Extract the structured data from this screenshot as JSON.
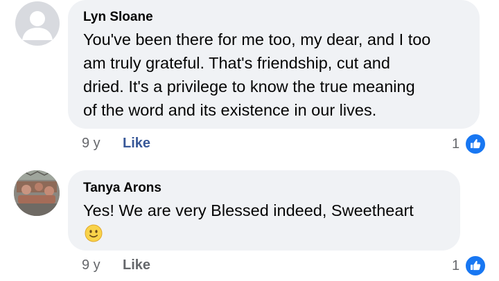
{
  "comments": [
    {
      "author": "Lyn Sloane",
      "text_lines": [
        "You've been there for me too, my dear, and I too",
        "am truly grateful.  That's friendship, cut and",
        "dried.  It's a privilege to know the true meaning",
        "of the word and its existence in our lives."
      ],
      "age": "9 y",
      "like_label": "Like",
      "reaction_count": "1",
      "avatar": "default-profile-avatar",
      "liked": true
    },
    {
      "author": "Tanya Arons",
      "text_lines": [
        "Yes!  We are very Blessed indeed, Sweetheart"
      ],
      "emoji": "slightly-smiling-face",
      "age": "9 y",
      "like_label": "Like",
      "reaction_count": "1",
      "avatar": "profile-photo",
      "liked": false
    }
  ],
  "colors": {
    "bubble": "#f0f2f5",
    "like_active": "#385898",
    "meta_gray": "#65676b",
    "reaction_blue": "#1877f2"
  }
}
